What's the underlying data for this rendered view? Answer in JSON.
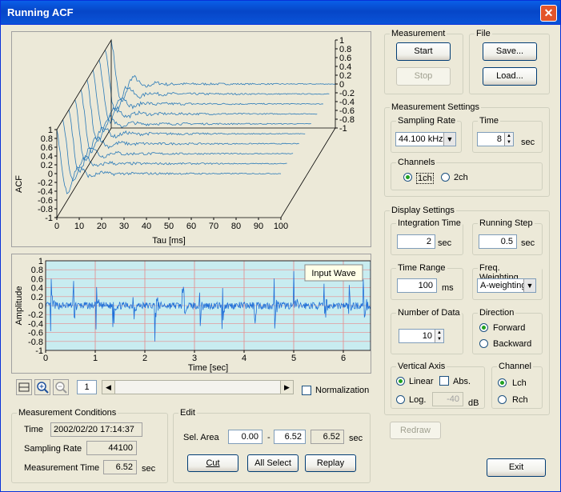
{
  "window": {
    "title": "Running ACF"
  },
  "acf_plot": {
    "ylabel": "ACF",
    "xlabel": "Tau [ms]",
    "x_ticks": [
      "0",
      "10",
      "20",
      "30",
      "40",
      "50",
      "60",
      "70",
      "80",
      "90",
      "100"
    ],
    "y_ticks": [
      "1",
      "0.8",
      "0.6",
      "0.4",
      "0.2",
      "0",
      "-0.2",
      "-0.4",
      "-0.6",
      "-0.8",
      "-1"
    ]
  },
  "wave_plot": {
    "ylabel": "Amplitude",
    "xlabel": "Time [sec]",
    "legend": "Input Wave",
    "x_ticks": [
      "0",
      "1",
      "2",
      "3",
      "4",
      "5",
      "6"
    ],
    "y_ticks": [
      "1",
      "0.8",
      "0.6",
      "0.4",
      "0.2",
      "0",
      "-0.2",
      "-0.4",
      "-0.6",
      "-0.8",
      "-1"
    ]
  },
  "toolbar": {
    "page": "1",
    "normalization_label": "Normalization",
    "normalization_checked": false
  },
  "measurement_conditions": {
    "legend": "Measurement Conditions",
    "time_label": "Time",
    "time_value": "2002/02/20 17:14:37",
    "rate_label": "Sampling Rate",
    "rate_value": "44100",
    "mtime_label": "Measurement Time",
    "mtime_value": "6.52",
    "mtime_unit": "sec"
  },
  "edit": {
    "legend": "Edit",
    "sel_area_label": "Sel. Area",
    "from": "0.00",
    "dash": "-",
    "to": "6.52",
    "length": "6.52",
    "unit": "sec",
    "cut": "Cut",
    "all_select": "All Select",
    "replay": "Replay"
  },
  "measurement": {
    "legend": "Measurement",
    "start": "Start",
    "stop": "Stop"
  },
  "file": {
    "legend": "File",
    "save": "Save...",
    "load": "Load..."
  },
  "measurement_settings": {
    "legend": "Measurement Settings",
    "sampling_rate_legend": "Sampling Rate",
    "sampling_rate": "44.100 kHz",
    "time_legend": "Time",
    "time_value": "8",
    "time_unit": "sec",
    "channels_legend": "Channels",
    "ch1": "1ch",
    "ch2": "2ch"
  },
  "display_settings": {
    "legend": "Display Settings",
    "integration_legend": "Integration Time",
    "integration_value": "2",
    "integration_unit": "sec",
    "running_step_legend": "Running Step",
    "running_step_value": "0.5",
    "running_step_unit": "sec",
    "time_range_legend": "Time Range",
    "time_range_value": "100",
    "time_range_unit": "ms",
    "freq_weighting_legend": "Freq. Weighting",
    "freq_weighting_value": "A-weighting",
    "number_data_legend": "Number of Data",
    "number_data_value": "10",
    "direction_legend": "Direction",
    "forward": "Forward",
    "backward": "Backward",
    "vertical_axis_legend": "Vertical Axis",
    "linear": "Linear",
    "abs": "Abs.",
    "log": "Log.",
    "log_value": "-40",
    "log_unit": "dB",
    "channel_legend": "Channel",
    "lch": "Lch",
    "rch": "Rch"
  },
  "buttons": {
    "redraw": "Redraw",
    "exit": "Exit"
  },
  "colors": {
    "trace": "#2a7ab8",
    "wave": "#1f6fd8",
    "wave_bg": "#c8ecf0",
    "grid": "#e88a8a"
  }
}
